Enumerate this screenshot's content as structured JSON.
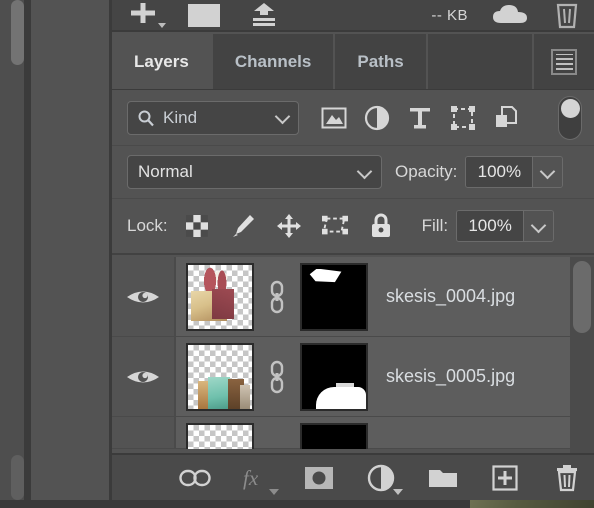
{
  "app": {
    "panel_title": "Layers"
  },
  "top_toolbar": {
    "items": [
      {
        "name": "add-library-item-button",
        "icon": "plus-icon"
      },
      {
        "name": "library-swatch-button",
        "icon": "square-swatch-icon"
      },
      {
        "name": "upload-to-library-button",
        "icon": "upload-icon"
      }
    ],
    "size_label": "-- KB",
    "cloud_icon": "cloud-icon",
    "delete_icon": "trash-icon"
  },
  "tabs": [
    {
      "label": "Layers",
      "active": true
    },
    {
      "label": "Channels",
      "active": false
    },
    {
      "label": "Paths",
      "active": false
    }
  ],
  "panel_menu": {
    "icon": "hamburger-menu-icon"
  },
  "filter_row": {
    "search_icon": "search-icon",
    "kind_label": "Kind",
    "chevron_icon": "chevron-down-icon",
    "filter_icons": [
      {
        "name": "filter-pixel-layers-icon",
        "title": "pixel"
      },
      {
        "name": "filter-adjustment-layers-icon",
        "title": "adjustment"
      },
      {
        "name": "filter-type-layers-icon",
        "title": "type"
      },
      {
        "name": "filter-shape-layers-icon",
        "title": "shape"
      },
      {
        "name": "filter-smart-object-layers-icon",
        "title": "smart object"
      }
    ],
    "toggle": {
      "name": "filter-enable-toggle",
      "state": "off"
    }
  },
  "blend_row": {
    "blend_mode": "Normal",
    "opacity_label": "Opacity:",
    "opacity_value": "100%"
  },
  "lock_row": {
    "lock_label": "Lock:",
    "lock_icons": [
      {
        "name": "lock-transparent-pixels-icon"
      },
      {
        "name": "lock-image-pixels-icon"
      },
      {
        "name": "lock-position-icon"
      },
      {
        "name": "lock-artboard-nesting-icon"
      },
      {
        "name": "lock-all-icon"
      }
    ],
    "fill_label": "Fill:",
    "fill_value": "100%"
  },
  "layers": [
    {
      "name": "skesis_0004.jpg",
      "visible": true,
      "selected": true,
      "linked_mask": true,
      "thumbnail": "transparent-with-coral-artwork",
      "mask": "black-with-white-shape-top-left"
    },
    {
      "name": "skesis_0005.jpg",
      "visible": true,
      "selected": true,
      "linked_mask": true,
      "thumbnail": "transparent-with-teal-brown-artwork",
      "mask": "black-with-white-shape-bottom"
    },
    {
      "name": "",
      "visible": true,
      "selected": false,
      "linked_mask": true,
      "thumbnail": "transparent-partial",
      "mask": "black-partial"
    }
  ],
  "bottom_toolbar": {
    "buttons": [
      {
        "name": "link-layers-button",
        "icon": "link-icon",
        "enabled": true
      },
      {
        "name": "layer-style-button",
        "icon": "fx-icon",
        "enabled": false
      },
      {
        "name": "add-layer-mask-button",
        "icon": "mask-icon",
        "enabled": true
      },
      {
        "name": "new-adjustment-layer-button",
        "icon": "adjustment-icon",
        "enabled": true
      },
      {
        "name": "new-group-button",
        "icon": "folder-icon",
        "enabled": true
      },
      {
        "name": "new-layer-button",
        "icon": "plus-square-icon",
        "enabled": true
      },
      {
        "name": "delete-layer-button",
        "icon": "trash-icon",
        "enabled": true
      }
    ]
  },
  "colors": {
    "panel_bg": "#535353",
    "toolbar_bg": "#4a4a4a",
    "row_selected": "#5d5d5d",
    "text": "#d9dde1",
    "accent_blue": "#b9c0c7"
  }
}
